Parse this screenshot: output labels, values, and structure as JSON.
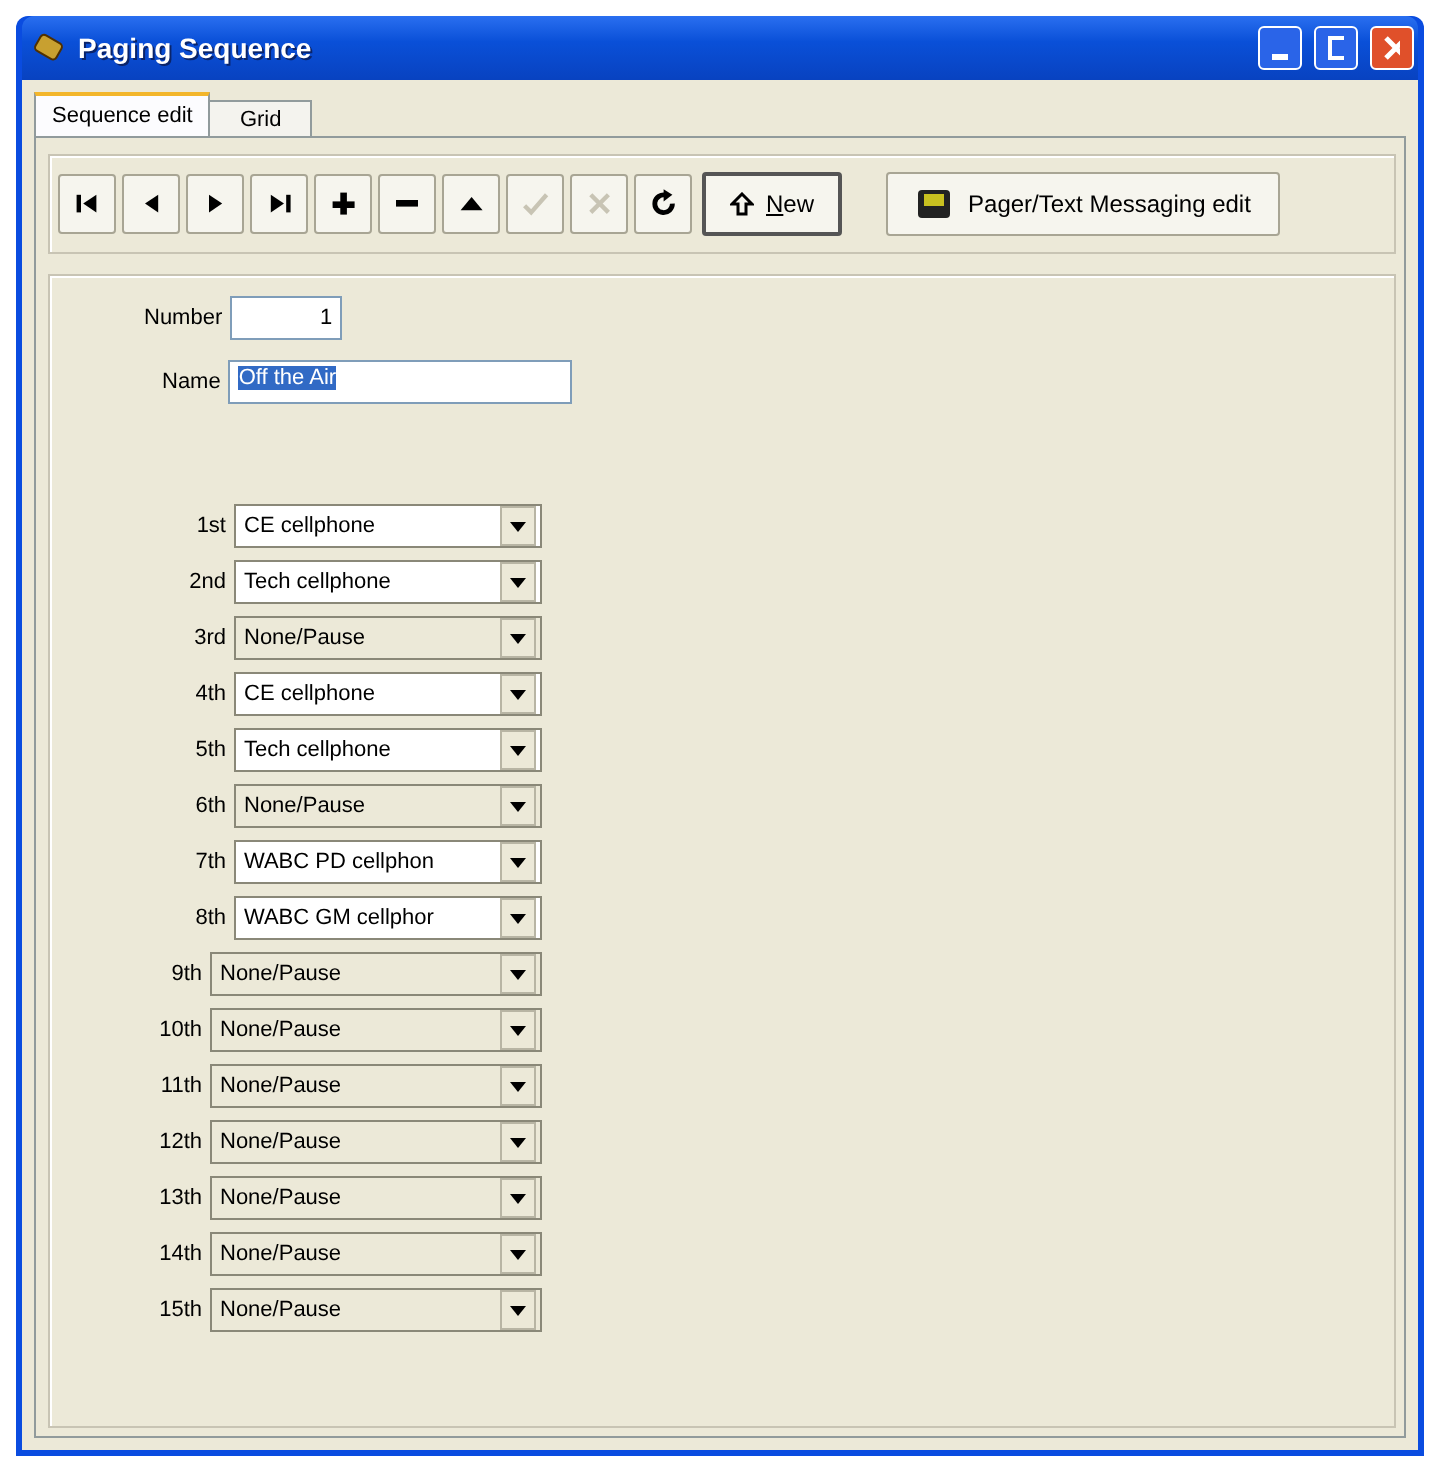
{
  "window": {
    "title": "Paging Sequence"
  },
  "tabs": [
    {
      "label": "Sequence edit",
      "selected": true
    },
    {
      "label": "Grid",
      "selected": false
    }
  ],
  "toolbar": [
    {
      "kind": "first",
      "disabled": false
    },
    {
      "kind": "prev",
      "disabled": false
    },
    {
      "kind": "next",
      "disabled": false
    },
    {
      "kind": "last",
      "disabled": false
    },
    {
      "kind": "add",
      "disabled": false
    },
    {
      "kind": "remove",
      "disabled": false
    },
    {
      "kind": "up",
      "disabled": false
    },
    {
      "kind": "check",
      "disabled": true
    },
    {
      "kind": "cancel",
      "disabled": true
    },
    {
      "kind": "refresh",
      "disabled": false
    }
  ],
  "new_button": {
    "label": "New"
  },
  "pager_button": {
    "label": "Pager/Text Messaging edit"
  },
  "number": {
    "label": "Number",
    "value": "1"
  },
  "name": {
    "label": "Name",
    "value": "Off the Air"
  },
  "sequence": [
    {
      "label": "1st",
      "value": "CE cellphone",
      "kind": "device"
    },
    {
      "label": "2nd",
      "value": "Tech cellphone",
      "kind": "device"
    },
    {
      "label": "3rd",
      "value": "None/Pause",
      "kind": "pause"
    },
    {
      "label": "4th",
      "value": "CE cellphone",
      "kind": "device"
    },
    {
      "label": "5th",
      "value": "Tech cellphone",
      "kind": "device"
    },
    {
      "label": "6th",
      "value": "None/Pause",
      "kind": "pause"
    },
    {
      "label": "7th",
      "value": "WABC PD cellphon",
      "kind": "device"
    },
    {
      "label": "8th",
      "value": "WABC GM cellphor",
      "kind": "device"
    },
    {
      "label": "9th",
      "value": "None/Pause",
      "kind": "pause"
    },
    {
      "label": "10th",
      "value": "None/Pause",
      "kind": "pause"
    },
    {
      "label": "11th",
      "value": "None/Pause",
      "kind": "pause"
    },
    {
      "label": "12th",
      "value": "None/Pause",
      "kind": "pause"
    },
    {
      "label": "13th",
      "value": "None/Pause",
      "kind": "pause"
    },
    {
      "label": "14th",
      "value": "None/Pause",
      "kind": "pause"
    },
    {
      "label": "15th",
      "value": "None/Pause",
      "kind": "pause"
    }
  ]
}
